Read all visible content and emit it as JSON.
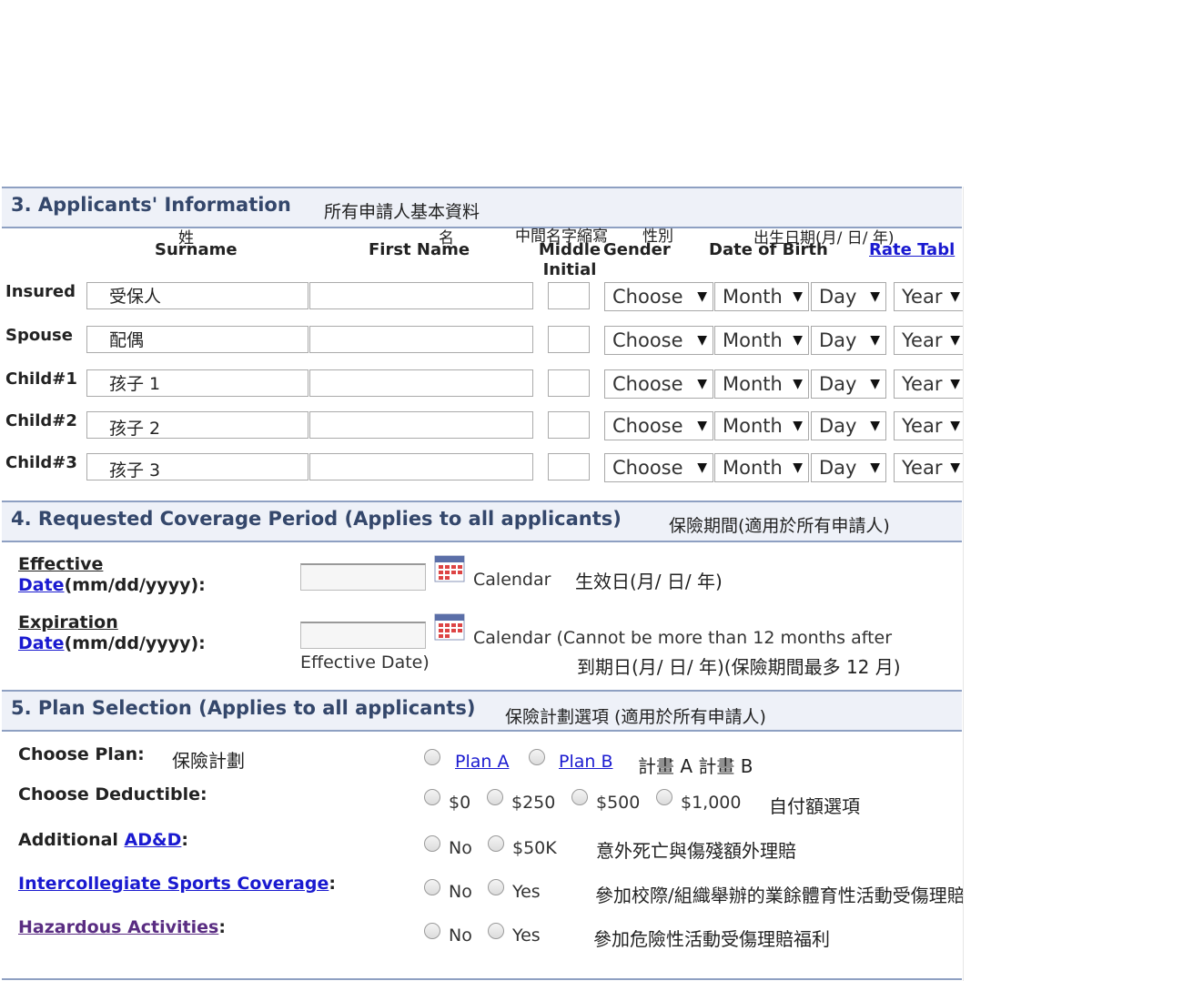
{
  "section3": {
    "title": "3. Applicants' Information",
    "zh": "所有申請人基本資料",
    "headers": {
      "surname_zh": "姓",
      "surname": "Surname",
      "first_zh": "名",
      "first": "First Name",
      "middle_zh": "中間名字縮寫",
      "middle": "Middle Initial",
      "gender_zh": "性別",
      "gender": "Gender",
      "dob_zh": "出生日期(月/ 日/ 年)",
      "dob": "Date of Birth",
      "rate": "Rate Tabl"
    },
    "rows": [
      {
        "label": "Insured",
        "surname": "受保人",
        "gender": "Choose",
        "month": "Month",
        "day": "Day",
        "year": "Year"
      },
      {
        "label": "Spouse",
        "surname": "配偶",
        "gender": "Choose",
        "month": "Month",
        "day": "Day",
        "year": "Year"
      },
      {
        "label": "Child#1",
        "surname": "孩子 1",
        "gender": "Choose",
        "month": "Month",
        "day": "Day",
        "year": "Year"
      },
      {
        "label": "Child#2",
        "surname": "孩子 2",
        "gender": "Choose",
        "month": "Month",
        "day": "Day",
        "year": "Year"
      },
      {
        "label": "Child#3",
        "surname": "孩子 3",
        "gender": "Choose",
        "month": "Month",
        "day": "Day",
        "year": "Year"
      }
    ]
  },
  "section4": {
    "title": "4. Requested Coverage Period (Applies to all applicants)",
    "zh": "保險期間(適用於所有申請人)",
    "effective_link1": "Effective",
    "effective_link2": "Date",
    "date_fmt": "(mm/dd/yyyy):",
    "calendar": "Calendar",
    "effective_zh": "生效日(月/ 日/ 年)",
    "expiration_link1": "Expiration",
    "expiration_link2": "Date",
    "expiration_note": "Calendar (Cannot be more than 12 months after",
    "expiration_note2": "Effective Date)",
    "expiration_zh": "到期日(月/ 日/ 年)(保險期間最多 12 月)"
  },
  "section5": {
    "title": "5. Plan Selection (Applies to all applicants)",
    "zh": "保險計劃選項 (適用於所有申請人)",
    "choose_plan": "Choose Plan:",
    "choose_plan_zh": "保險計劃",
    "plan_a": "Plan A",
    "plan_b": "Plan B",
    "plan_zh": "計畫 A  計畫 B",
    "deductible": "Choose Deductible:",
    "ded_options": [
      "$0",
      "$250",
      "$500",
      "$1,000"
    ],
    "deductible_zh": "自付額選項",
    "add_prefix": "Additional ",
    "add_link": "AD&D",
    "add_suffix": ":",
    "add_options": [
      "No",
      "$50K"
    ],
    "add_zh": "意外死亡與傷殘額外理賠",
    "sports_link": "Intercollegiate Sports Coverage",
    "sports_suffix": ":",
    "sports_options": [
      "No",
      "Yes"
    ],
    "sports_zh": "參加校際/組織舉辦的業餘體育性活動受傷理賠福利",
    "haz_link": "Hazardous Activities",
    "haz_suffix": ":",
    "haz_options": [
      "No",
      "Yes"
    ],
    "haz_zh": "參加危險性活動受傷理賠福利"
  }
}
